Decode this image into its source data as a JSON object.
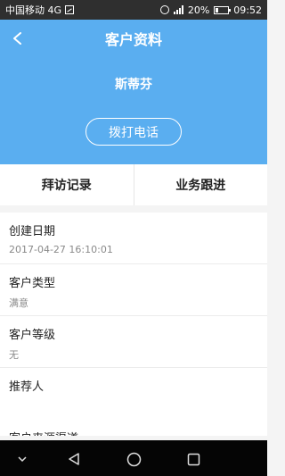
{
  "status_bar": {
    "carrier": "中国移动 4G",
    "battery": "20%",
    "time": "09:52"
  },
  "header": {
    "title": "客户资料",
    "customer_name": "斯蒂芬",
    "call_button": "拨打电话"
  },
  "tabs": [
    {
      "label": "拜访记录"
    },
    {
      "label": "业务跟进"
    }
  ],
  "fields": [
    {
      "label": "创建日期",
      "value": "2017-04-27 16:10:01"
    },
    {
      "label": "客户类型",
      "value": "满意"
    },
    {
      "label": "客户等级",
      "value": "无"
    },
    {
      "label": "推荐人",
      "value": ""
    },
    {
      "label": "客户来源渠道",
      "value": ""
    }
  ]
}
